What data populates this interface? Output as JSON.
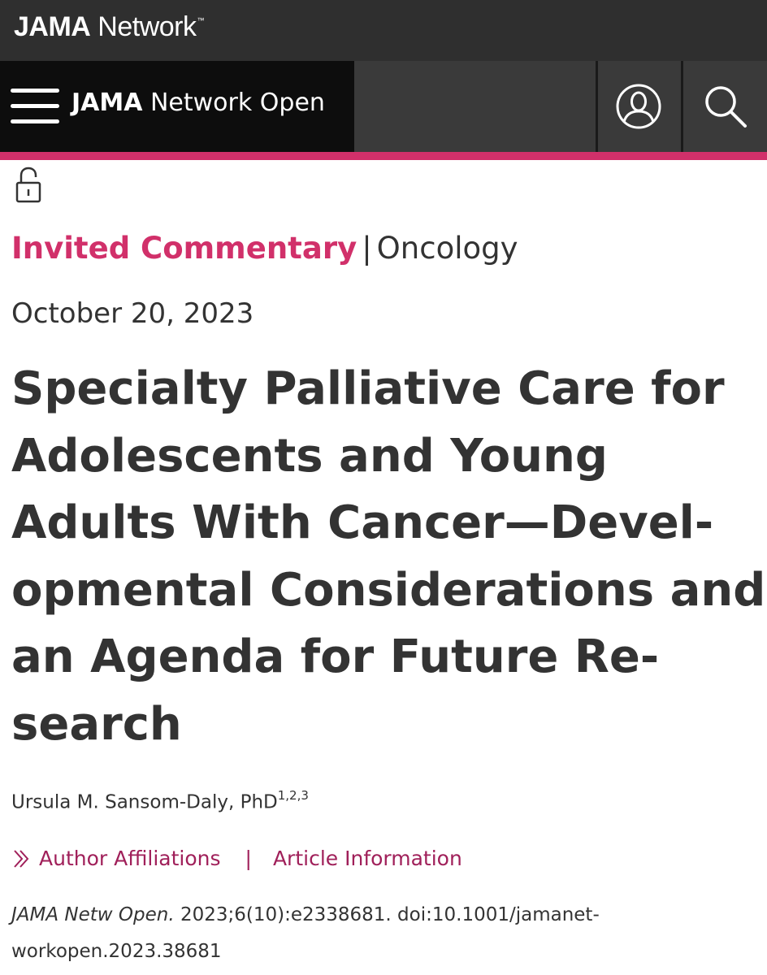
{
  "top_bar": {
    "logo_bold": "JAMA",
    "logo_rest": " Network",
    "logo_tm": "™"
  },
  "nav": {
    "journal_bold": "JAMA",
    "journal_rest": " Network Open",
    "menu_icon": "hamburger-menu-icon",
    "account_icon": "user-account-icon",
    "search_icon": "search-icon"
  },
  "colors": {
    "accent": "#d1306a",
    "link": "#a0205a",
    "text": "#333333",
    "top_bar_bg": "#2f2f2f",
    "nav_bg": "#0d0d0d"
  },
  "article": {
    "access_icon": "unlocked-open-access-icon",
    "category": "Invited Commentary",
    "separator": "|",
    "subject": "Oncology",
    "date": "October 20, 2023",
    "title_lines": [
      "Specialty Palliative Care for",
      "Adolescents and Young",
      "Adults With Cancer—Devel-",
      "opmental Considerations and",
      "an Agenda for Future Re-",
      "search"
    ],
    "author_name": "Ursula M. Sansom-Daly, PhD",
    "author_affil_marks": "1,2,3",
    "links": {
      "affiliations": "Author Affiliations",
      "separator": "|",
      "article_info": "Article Information"
    },
    "citation": {
      "journal": "JAMA Netw Open.",
      "details": " 2023;6(10):e2338681. doi:10.1001/jamanet-",
      "details_line2": "workopen.2023.38681"
    }
  }
}
